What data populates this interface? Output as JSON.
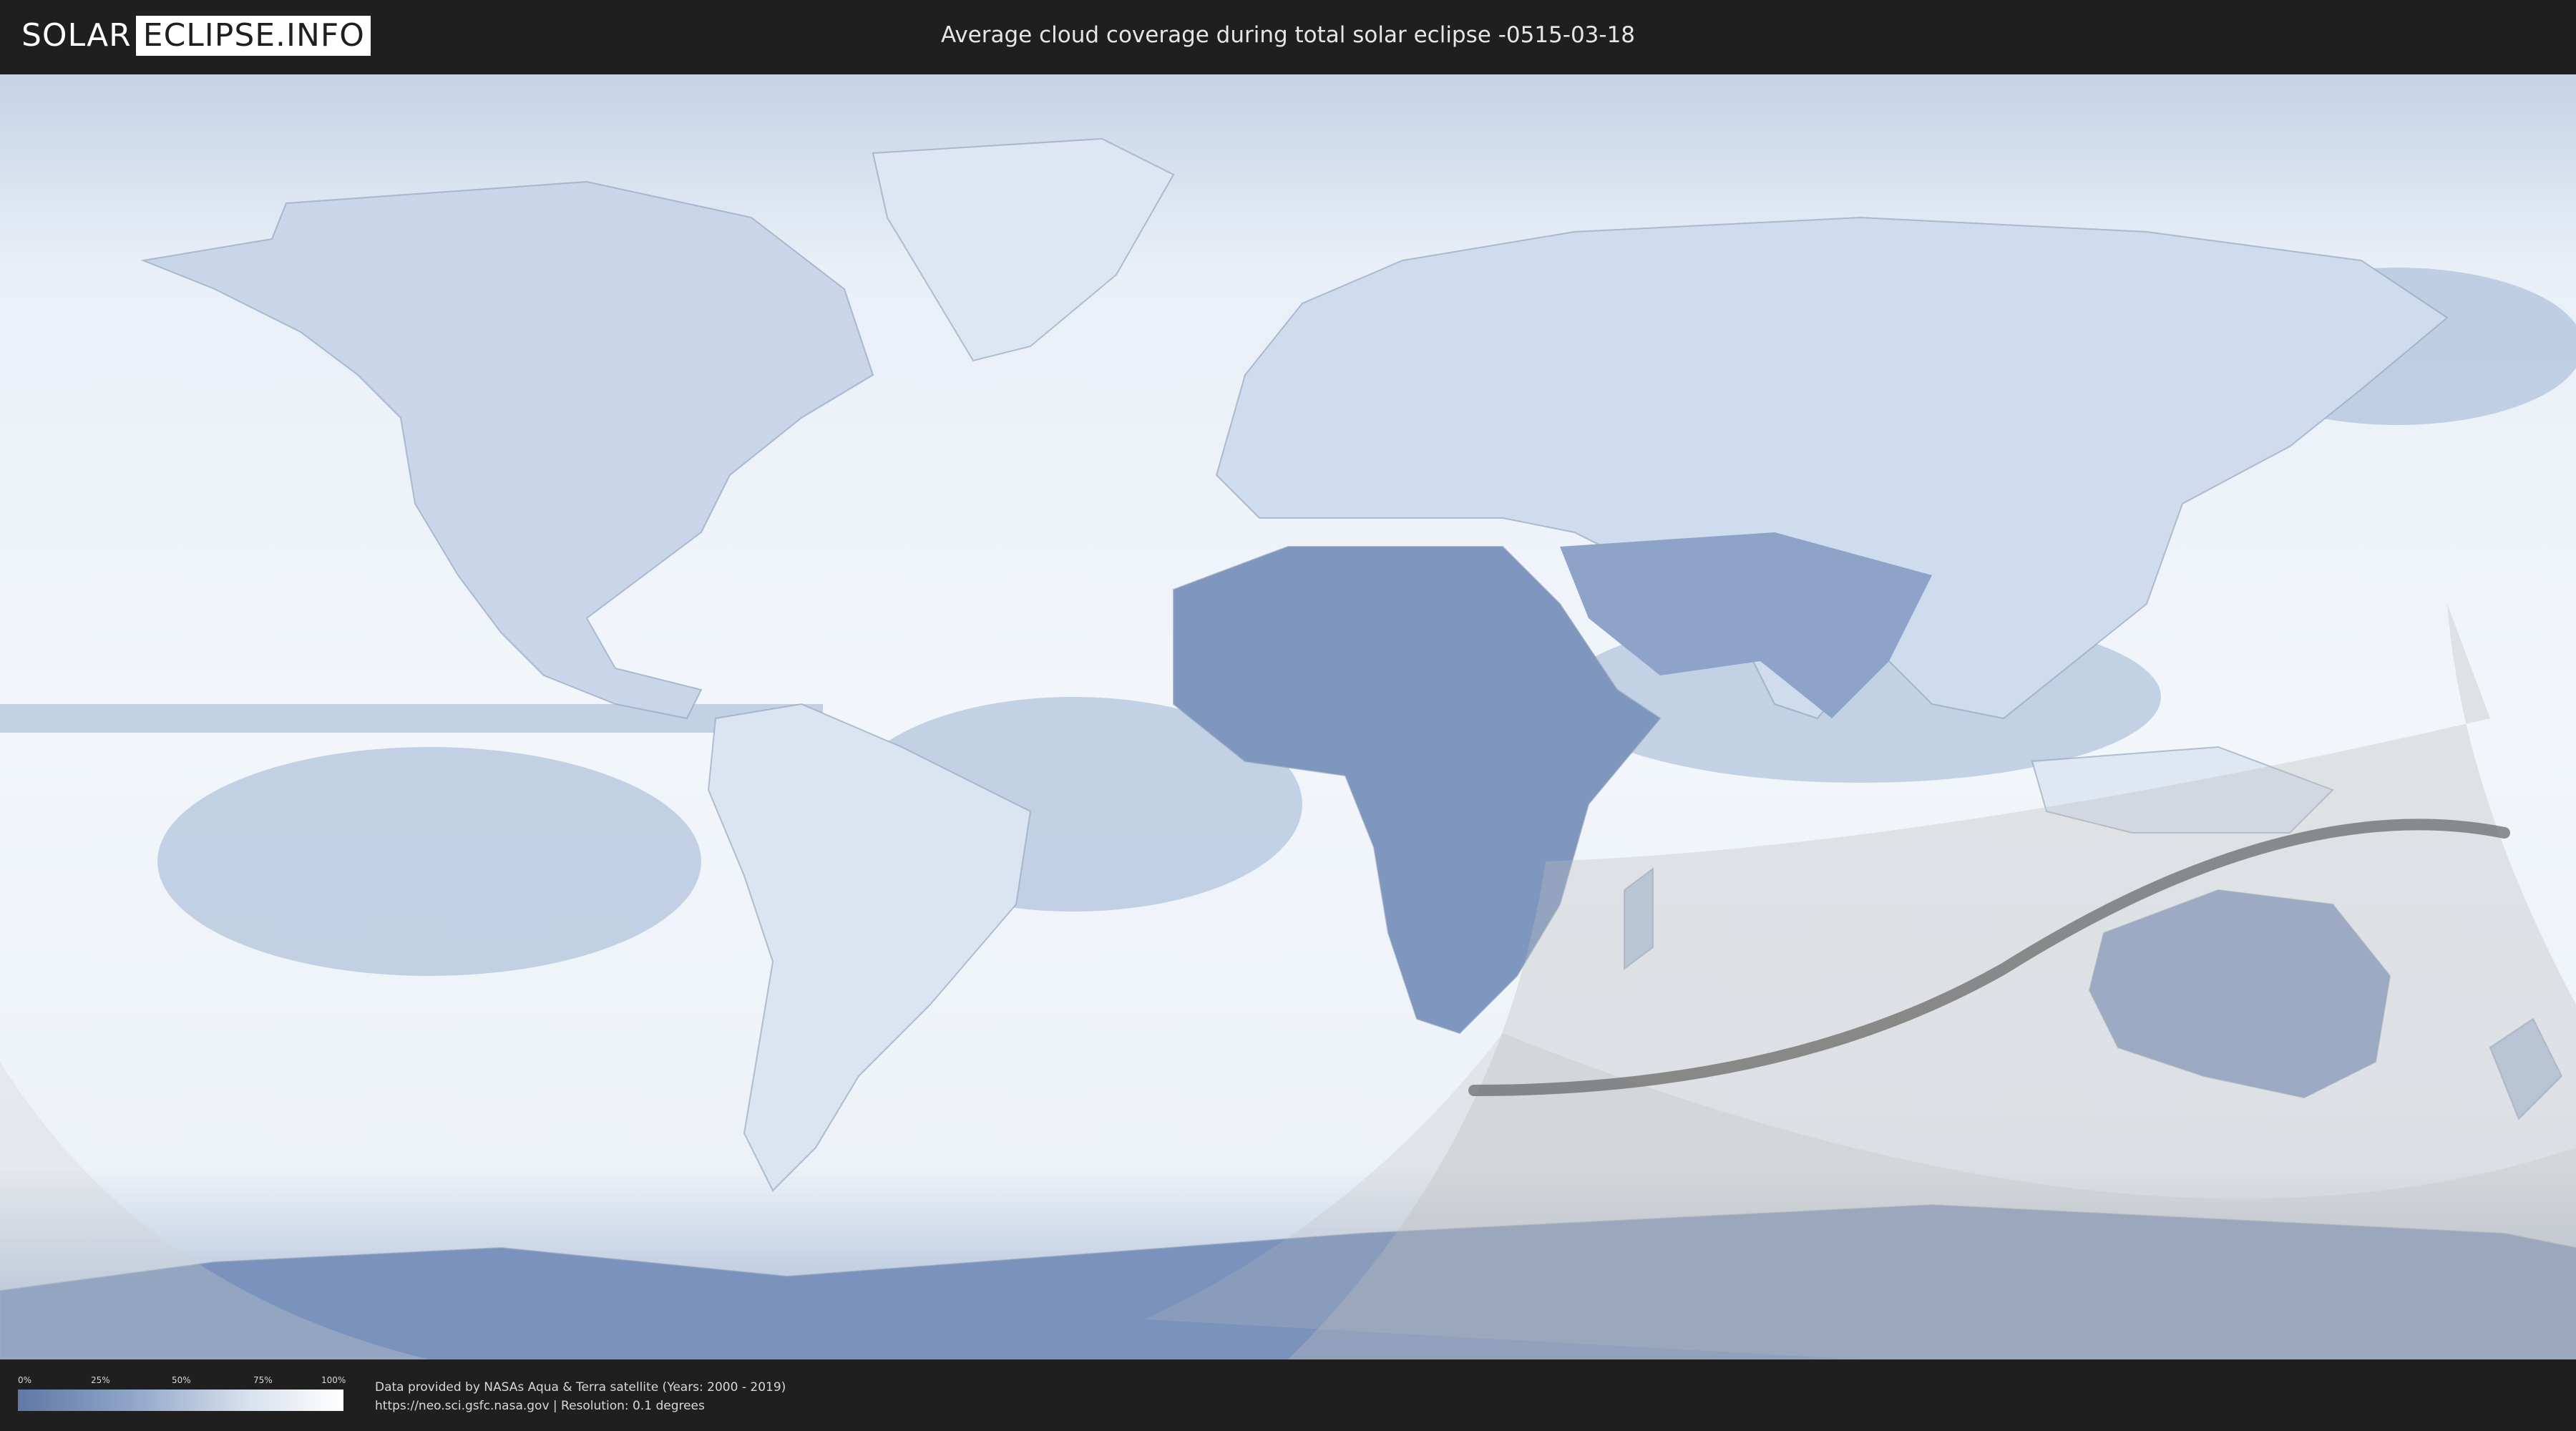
{
  "header": {
    "logo_left": "SOLAR",
    "logo_right": "ECLIPSE.INFO",
    "title": "Average cloud coverage during total solar eclipse -0515-03-18"
  },
  "colors": {
    "background": "#1f1f1f",
    "ocean_cloud_light": "#f2f6fb",
    "cloud_mid": "#b3c4de",
    "cloud_dark": "#5f78a5",
    "eclipse_shadow": "#bdbdbd",
    "path_line": "#6b6b6b"
  },
  "legend": {
    "ticks": [
      "0%",
      "25%",
      "50%",
      "75%",
      "100%"
    ]
  },
  "credits": {
    "line1": "Data provided by NASAs Aqua & Terra satellite (Years: 2000 - 2019)",
    "line2": "https://neo.sci.gsfc.nasa.gov | Resolution: 0.1 degrees"
  }
}
